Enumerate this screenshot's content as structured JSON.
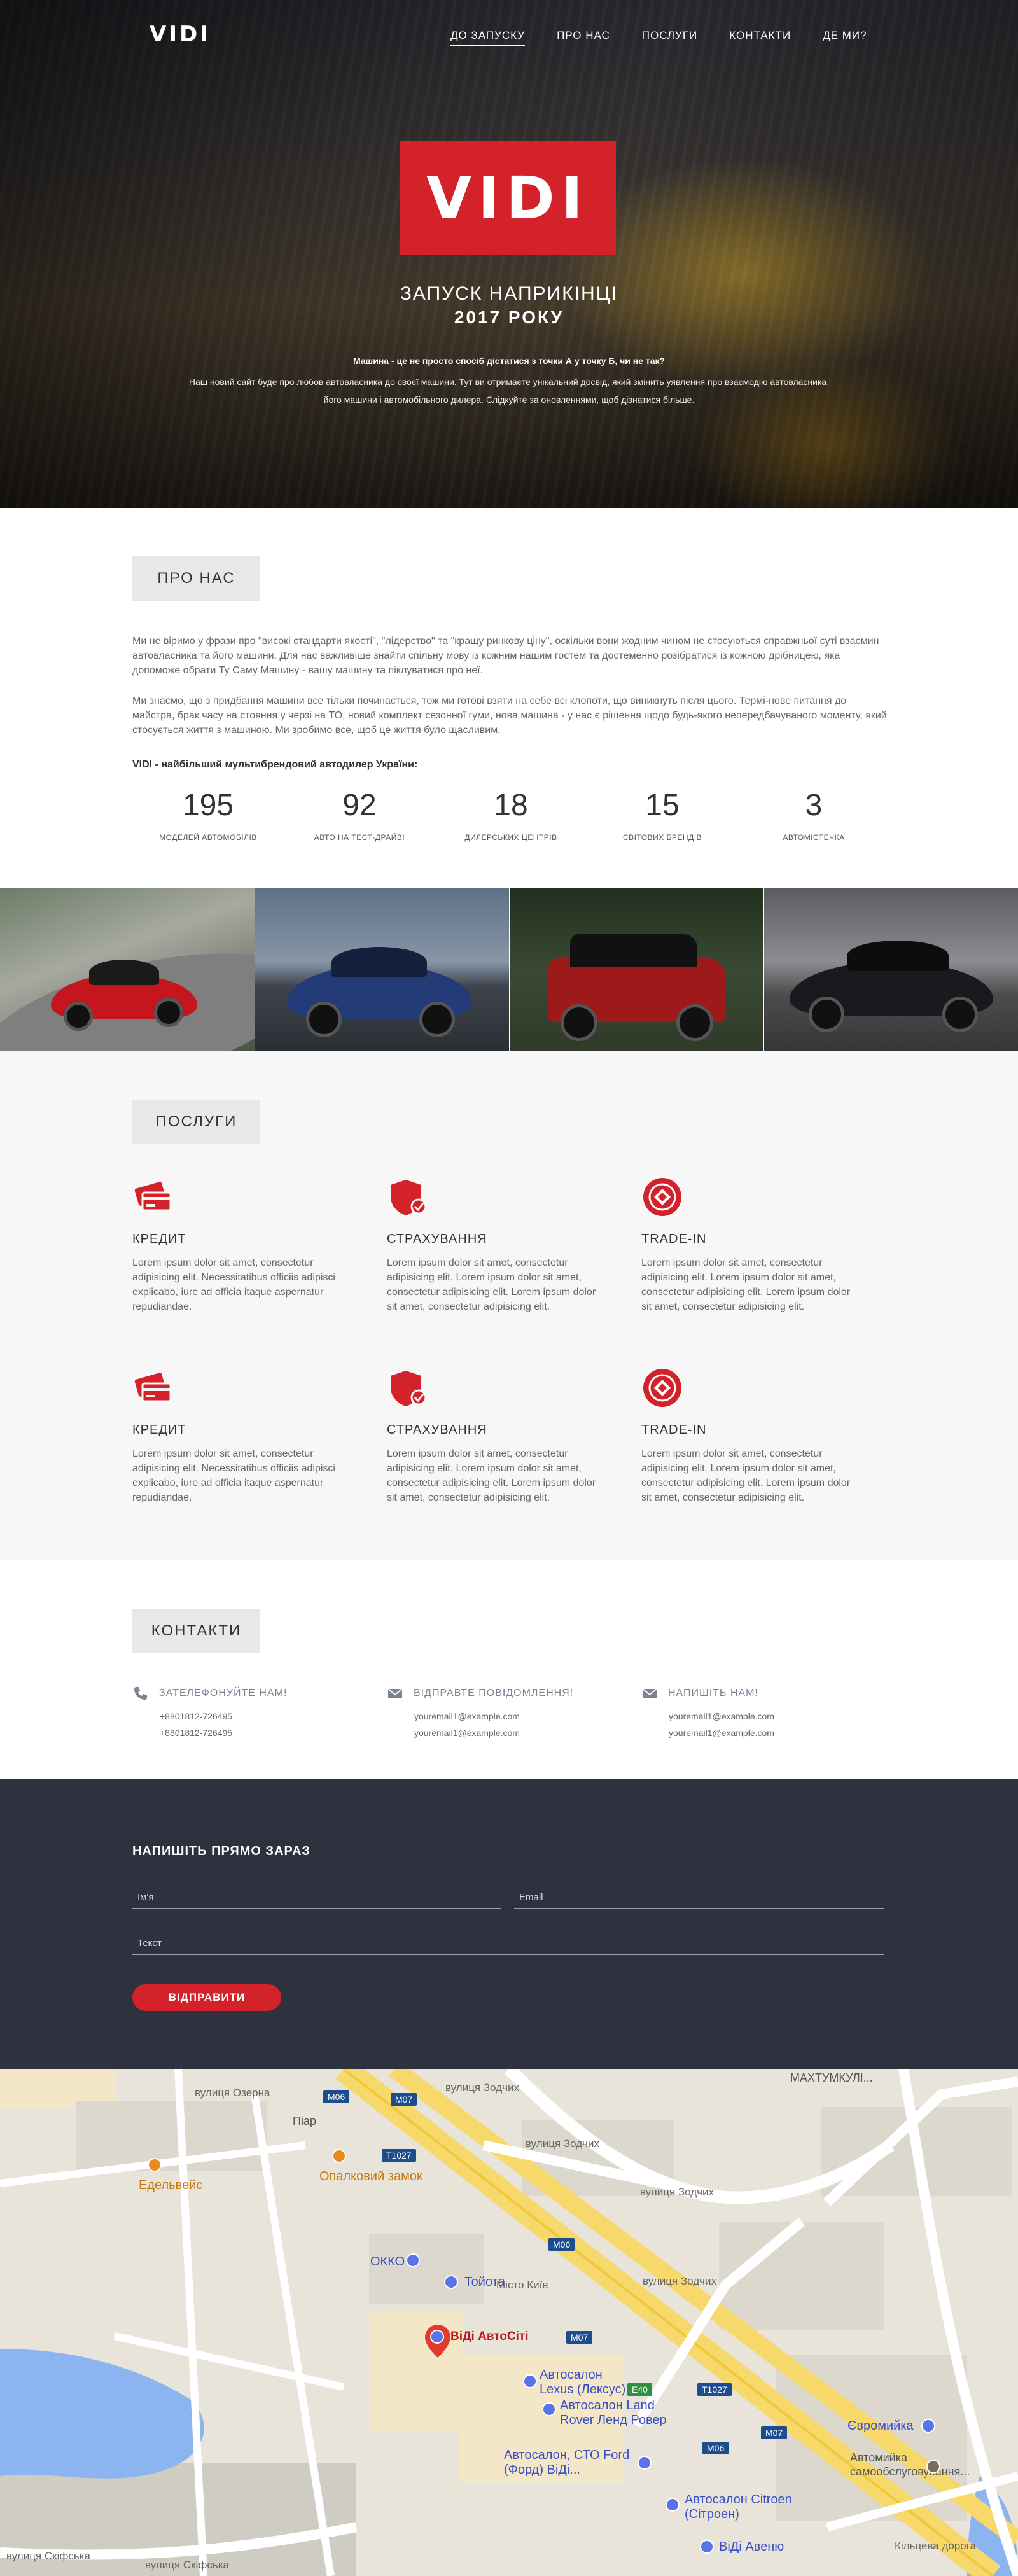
{
  "brand": {
    "logo_text": "VIDI",
    "accent": "#d4222a",
    "dark_bg": "#2e323f"
  },
  "nav": {
    "items": [
      {
        "label": "ДО ЗАПУСКУ",
        "active": true
      },
      {
        "label": "ПРО НАС",
        "active": false
      },
      {
        "label": "ПОСЛУГИ",
        "active": false
      },
      {
        "label": "КОНТАКТИ",
        "active": false
      },
      {
        "label": "ДЕ МИ?",
        "active": false
      }
    ]
  },
  "hero": {
    "badge_text": "VIDI",
    "title": "ЗАПУСК НАПРИКІНЦІ",
    "year": "2017 РОКУ",
    "lead": "Машина - це не просто спосіб дістатися з точки А у точку Б, чи не так?",
    "text": "Наш новий сайт буде про любов автовласника до своєї машини. Тут ви отримаєте унікальний досвід, який змінить уявлення про взаємодію автовласника, його машини і автомобільного дилера. Слідкуйте за оновленнями, щоб дізнатися більше."
  },
  "about": {
    "label": "ПРО НАС",
    "p1": "Ми не віримо у фрази про \"високі стандарти якості\", \"лідерство\" та \"кращу ринкову ціну\", оскільки вони жодним чином не стосуються справжньої суті взаємин автовласника та його машини. Для нас важливіше знайти спільну мову із кожним нашим гостем та достеменно розібратися із кожною дрібницею, яка допоможе обрати Ту Саму Машину - вашу машину та піклуватися про неї.",
    "p2": "Ми знаємо, що з придбання машини все тільки починається, тож ми готові взяти на себе всі клопоти, що виникнуть після цього. Термі-нове питання до майстра, брак часу на стояння у черзі на ТО, новий комплект сезонної гуми, нова машина - у нас є рішення щодо будь-якого непередбачуваного моменту, який стосується життя з машиною.  Ми зробимо все, щоб це життя було щасливим.",
    "p3": "VIDI - найбільший мультибрендовий автодилер України:",
    "stats": [
      {
        "value": "195",
        "label": "МОДЕЛЕЙ АВТОМОБІЛІВ"
      },
      {
        "value": "92",
        "label": "АВТО НА ТЕСТ-ДРАЙВ!"
      },
      {
        "value": "18",
        "label": "ДИЛЕРСЬКИХ ЦЕНТРІВ"
      },
      {
        "value": "15",
        "label": "СВІТОВИХ БРЕНДІВ"
      },
      {
        "value": "3",
        "label": "АВТОМІСТЕЧКА"
      }
    ]
  },
  "gallery": {
    "cars": [
      {
        "name": "red-sports-coupe",
        "color": "#c4161c"
      },
      {
        "name": "blue-luxury-coupe",
        "color": "#233c78"
      },
      {
        "name": "red-suv",
        "color": "#9e1a1a"
      },
      {
        "name": "black-sedan",
        "color": "#1a1a1e"
      }
    ]
  },
  "services": {
    "label": "ПОСЛУГИ",
    "items": [
      {
        "icon": "credit-card-icon",
        "title": "КРЕДИТ",
        "text": "Lorem ipsum dolor sit amet, consectetur adipisicing elit. Necessitatibus officiis adipisci explicabo, iure ad officia itaque aspernatur repudiandae."
      },
      {
        "icon": "shield-check-icon",
        "title": "СТРАХУВАННЯ",
        "text": "Lorem ipsum dolor sit amet, consectetur adipisicing elit. Lorem ipsum dolor sit amet, consectetur adipisicing elit. Lorem ipsum dolor sit amet, consectetur adipisicing elit."
      },
      {
        "icon": "trade-in-icon",
        "title": "TRADE-IN",
        "text": "Lorem ipsum dolor sit amet, consectetur adipisicing elit. Lorem ipsum dolor sit amet, consectetur adipisicing elit. Lorem ipsum dolor sit amet, consectetur adipisicing elit."
      },
      {
        "icon": "credit-card-icon",
        "title": "КРЕДИТ",
        "text": "Lorem ipsum dolor sit amet, consectetur adipisicing elit. Necessitatibus officiis adipisci explicabo, iure ad officia itaque aspernatur repudiandae."
      },
      {
        "icon": "shield-check-icon",
        "title": "СТРАХУВАННЯ",
        "text": "Lorem ipsum dolor sit amet, consectetur adipisicing elit. Lorem ipsum dolor sit amet, consectetur adipisicing elit. Lorem ipsum dolor sit amet, consectetur adipisicing elit."
      },
      {
        "icon": "trade-in-icon",
        "title": "TRADE-IN",
        "text": "Lorem ipsum dolor sit amet, consectetur adipisicing elit. Lorem ipsum dolor sit amet, consectetur adipisicing elit. Lorem ipsum dolor sit amet, consectetur adipisicing elit."
      }
    ]
  },
  "contacts": {
    "label": "КОНТАКТИ",
    "columns": [
      {
        "icon": "phone-icon",
        "title": "ЗАТЕЛЕФОНУЙТЕ НАМ!",
        "lines": [
          "+8801812-726495",
          "+8801812-726495"
        ]
      },
      {
        "icon": "envelope-icon",
        "title": "ВІДПРАВТЕ ПОВІДОМЛЕННЯ!",
        "lines": [
          "youremail1@example.com",
          "youremail1@example.com"
        ]
      },
      {
        "icon": "envelope-icon",
        "title": "НАПИШІТЬ НАМ!",
        "lines": [
          "youremail1@example.com",
          "youremail1@example.com"
        ]
      }
    ]
  },
  "form": {
    "title": "НАПИШІТЬ ПРЯМО ЗАРАЗ",
    "name_placeholder": "Ім'я",
    "email_placeholder": "Email",
    "text_placeholder": "Текст",
    "submit": "ВІДПРАВИТИ"
  },
  "map": {
    "labels": {
      "makhtumkuli": "МАХТУМКУЛІ...",
      "zodchykh_1": "вулиця Зодчих",
      "zodchykh_2": "вулиця Зодчих",
      "zodchykh_3": "вулиця Зодчих",
      "zodchykh_4": "вулиця Зодчих",
      "ozerna": "вулиця Озерна",
      "kyiv_ave": "Місто Київ",
      "kiltseva": "Кільцева дорога",
      "skyfska": "вулиця Скіфська",
      "skyfska2": "вулиця Скіфська",
      "piar": "Піар",
      "edelveis": "Едельвейс",
      "opalovyi": "Опалковий замок",
      "okko": "ОККО",
      "toyota": "Тойота",
      "vidi_avtosity": "ВіДі АвтоСіті",
      "lexus": "Автосалон Lexus (Лексус)",
      "landrover": "Автосалон Land Rover Ленд Ровер",
      "ford": "Автосалон, СТО Ford (Форд) ВіДі...",
      "citroen": "Автосалон Citroen (Сітроен)",
      "avenue": "ВіДі Авеню",
      "evromiyka": "Євромийка",
      "avtomiyka": "Автомийка самообслуговування..."
    },
    "shields": [
      "M06",
      "M07",
      "T1027",
      "M06",
      "M07",
      "E40",
      "T1027",
      "M07",
      "M06"
    ]
  }
}
